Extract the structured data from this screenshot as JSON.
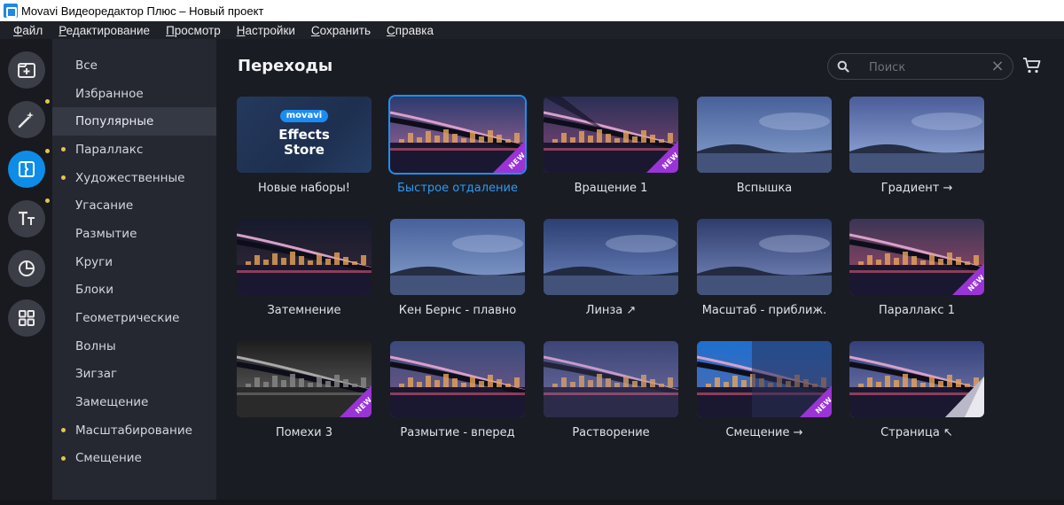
{
  "window": {
    "title": "Movavi Видеоредактор Плюс – Новый проект"
  },
  "menu": [
    {
      "label": "Файл"
    },
    {
      "label": "Редактирование"
    },
    {
      "label": "Просмотр"
    },
    {
      "label": "Настройки"
    },
    {
      "label": "Сохранить"
    },
    {
      "label": "Справка"
    }
  ],
  "tools": [
    {
      "icon": "import-icon",
      "active": false,
      "dot": false
    },
    {
      "icon": "magic-wand-icon",
      "active": false,
      "dot": true
    },
    {
      "icon": "transitions-icon",
      "active": true,
      "dot": true
    },
    {
      "icon": "titles-icon",
      "active": false,
      "dot": true
    },
    {
      "icon": "stickers-icon",
      "active": false,
      "dot": false
    },
    {
      "icon": "more-tools-icon",
      "active": false,
      "dot": false
    }
  ],
  "categories": [
    {
      "label": "Все",
      "dot": false,
      "active": false
    },
    {
      "label": "Избранное",
      "dot": false,
      "active": false
    },
    {
      "label": "Популярные",
      "dot": false,
      "active": true
    },
    {
      "label": "Параллакс",
      "dot": true,
      "active": false
    },
    {
      "label": "Художественные",
      "dot": true,
      "active": false
    },
    {
      "label": "Угасание",
      "dot": false,
      "active": false
    },
    {
      "label": "Размытие",
      "dot": false,
      "active": false
    },
    {
      "label": "Круги",
      "dot": false,
      "active": false
    },
    {
      "label": "Блоки",
      "dot": false,
      "active": false
    },
    {
      "label": "Геометрические",
      "dot": false,
      "active": false
    },
    {
      "label": "Волны",
      "dot": false,
      "active": false
    },
    {
      "label": "Зигзаг",
      "dot": false,
      "active": false
    },
    {
      "label": "Замещение",
      "dot": false,
      "active": false
    },
    {
      "label": "Масштабирование",
      "dot": true,
      "active": false
    },
    {
      "label": "Смещение",
      "dot": true,
      "active": false
    }
  ],
  "main": {
    "heading": "Переходы",
    "search": {
      "placeholder": "Поиск",
      "value": ""
    },
    "store_card": {
      "brand": "movavi",
      "line1": "Effects",
      "line2": "Store"
    },
    "new_badge": "NEW",
    "transitions": [
      {
        "label": "Новые наборы!",
        "kind": "store",
        "new": false,
        "selected": false
      },
      {
        "label": "Быстрое отдаление",
        "kind": "bridge",
        "new": true,
        "selected": true
      },
      {
        "label": "Вращение 1",
        "kind": "rotate",
        "new": true,
        "selected": false
      },
      {
        "label": "Вспышка",
        "kind": "island",
        "new": false,
        "selected": false
      },
      {
        "label": "Градиент →",
        "kind": "island-bright",
        "new": false,
        "selected": false
      },
      {
        "label": "Затемнение",
        "kind": "bridge-dark",
        "new": false,
        "selected": false
      },
      {
        "label": "Кен Бернс - плавно",
        "kind": "island",
        "new": false,
        "selected": false
      },
      {
        "label": "Линза ↗",
        "kind": "lens",
        "new": false,
        "selected": false
      },
      {
        "label": "Масштаб - приближ.",
        "kind": "split",
        "new": false,
        "selected": false
      },
      {
        "label": "Параллакс 1",
        "kind": "bridge-red",
        "new": true,
        "selected": false
      },
      {
        "label": "Помехи 3",
        "kind": "bridge-gray",
        "new": true,
        "selected": false
      },
      {
        "label": "Размытие - вперед",
        "kind": "bridge-soft",
        "new": false,
        "selected": false
      },
      {
        "label": "Растворение",
        "kind": "dissolve",
        "new": false,
        "selected": false
      },
      {
        "label": "Смещение →",
        "kind": "shift",
        "new": true,
        "selected": false
      },
      {
        "label": "Страница ↖",
        "kind": "page",
        "new": false,
        "selected": false
      }
    ]
  }
}
